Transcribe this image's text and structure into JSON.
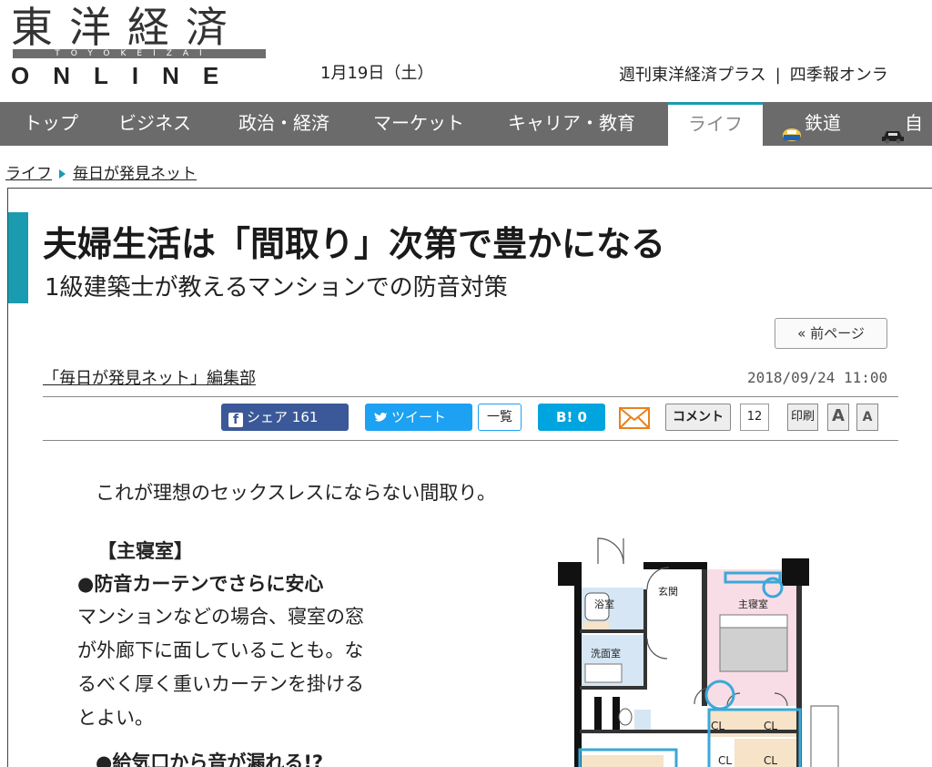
{
  "header": {
    "logo_kanji": "東洋経済",
    "logo_roman": "TOYOKEIZAI",
    "logo_online": "ONLINE",
    "date": "1月19日（土）",
    "links": [
      "週刊東洋経済プラス",
      "四季報オンラ"
    ],
    "link_separator": "|"
  },
  "nav": {
    "items": [
      "トップ",
      "ビジネス",
      "政治・経済",
      "マーケット",
      "キャリア・教育",
      "ライフ",
      "鉄道",
      "自"
    ],
    "active": "ライフ"
  },
  "breadcrumb": {
    "items": [
      "ライフ",
      "毎日が発見ネット"
    ]
  },
  "article": {
    "title": "夫婦生活は「間取り」次第で豊かになる",
    "subtitle": "1級建築士が教えるマンションでの防音対策",
    "prev_page_label": "« 前ページ",
    "author": "「毎日が発見ネット」編集部",
    "timestamp": "2018/09/24 11:00",
    "lead": "これが理想のセックスレスにならない間取り。",
    "section_heading": "【主寝室】",
    "sub_heading": "●防音カーテンでさらに安心",
    "body_lines": [
      "マンションなどの場合、寝室の窓",
      "が外廊下に面していることも。な",
      "るべく厚く重いカーテンを掛ける",
      "とよい。"
    ],
    "next_heading_partial": "●給気口から音が漏れる!?"
  },
  "social": {
    "facebook_label": "シェア",
    "facebook_count": "161",
    "tweet_label": "ツイート",
    "tweet_list": "一覧",
    "hatena_label": "B!",
    "hatena_count": "0",
    "comment_label": "コメント",
    "comment_count": "12",
    "print_label": "印刷",
    "font_large": "A",
    "font_small": "A"
  },
  "floorplan": {
    "labels": {
      "bath": "浴室",
      "entrance": "玄関",
      "master_bedroom": "主寝室",
      "washroom": "洗面室",
      "closet": "CL"
    }
  },
  "colors": {
    "accent": "#1a9bb0",
    "nav_bg": "#6b6b6b",
    "facebook": "#3b5998",
    "twitter": "#1da1f2",
    "hatena": "#00a4de",
    "bedroom_fill": "#f9dde6",
    "bath_fill": "#d6e6f5",
    "highlight": "#3aa8d8"
  }
}
